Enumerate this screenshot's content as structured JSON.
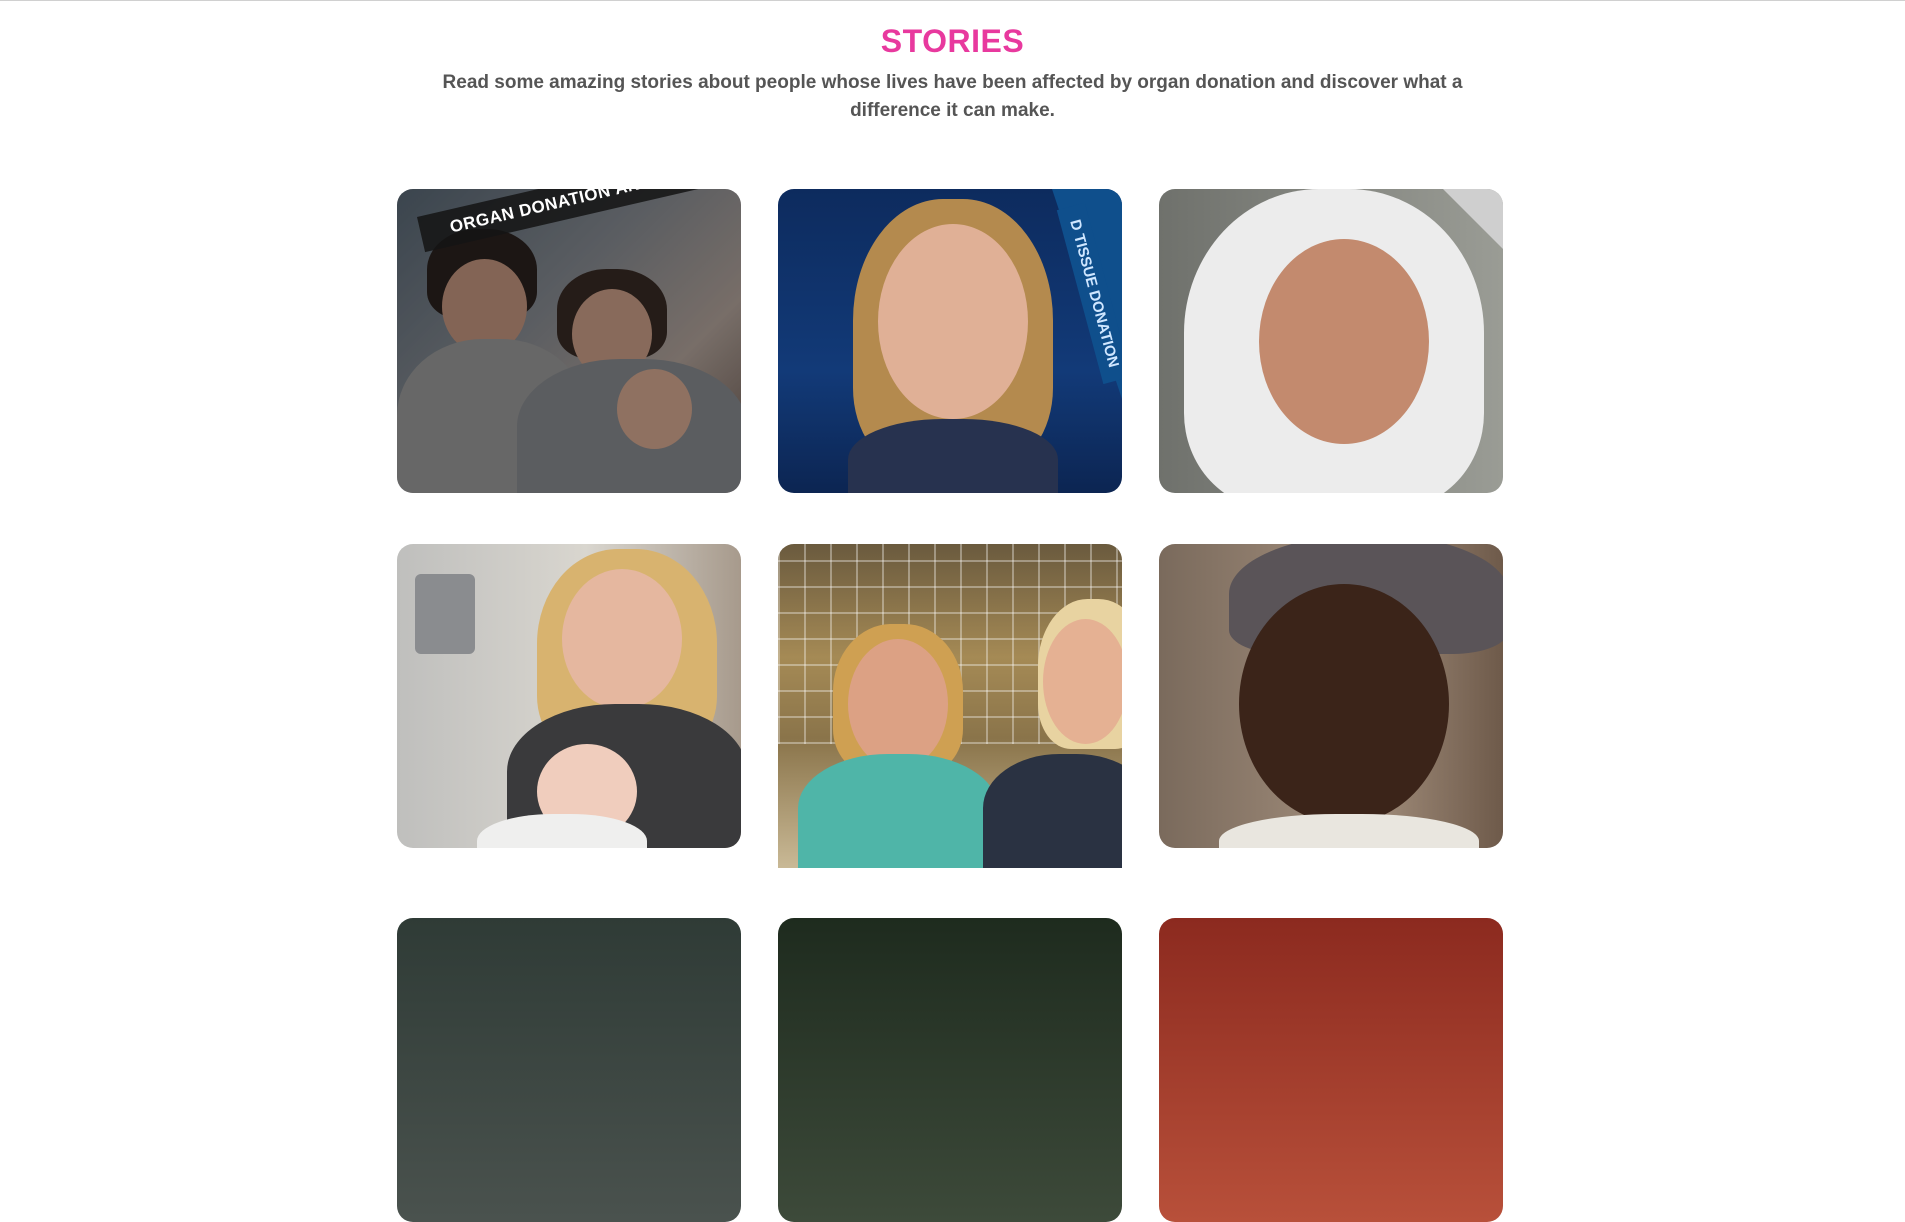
{
  "header": {
    "title": "STORIES",
    "intro": "Read some amazing stories about people whose lives have been affected by organ donation and discover what a difference it can make."
  },
  "cards": [
    {
      "ribbon": "ORGAN DONATION AND IN"
    },
    {
      "ribbon": "D TISSUE DONATION"
    },
    {},
    {},
    {},
    {},
    {},
    {},
    {}
  ]
}
